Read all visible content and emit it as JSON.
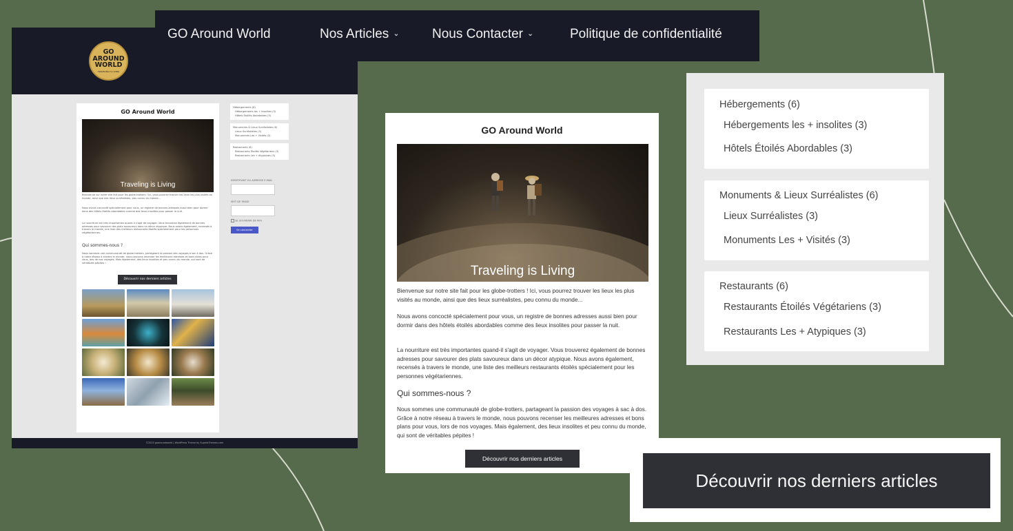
{
  "colors": {
    "background": "#566b4c",
    "header_dark": "#181b27",
    "button_dark": "#2f3036",
    "login_blue": "#4a58c7",
    "logo_gold": "#d9b45a"
  },
  "navbar": {
    "brand": "GO Around World",
    "items": [
      {
        "label": "Nos Articles",
        "icon": "chevron-down-icon"
      },
      {
        "label": "Nous Contacter",
        "icon": "chevron-down-icon"
      },
      {
        "label": "Politique de confidentialité"
      }
    ]
  },
  "logo": {
    "line1": "GO",
    "line2": "AROUND",
    "line3": "WORLD",
    "tagline": "TRAVELING IS LIVING"
  },
  "article": {
    "title": "GO Around World",
    "hero_caption": "Traveling is Living",
    "p1": "Bienvenue sur notre site fait pour les globe-trotters ! Ici, vous pourrez trouver les lieux les plus visités au monde, ainsi que des lieux surréalistes, peu connu du monde...",
    "p2": "Nous avons concocté spécialement pour vous, un registre de bonnes adresses aussi bien pour dormir dans des hôtels étoilés abordables comme des lieux insolites pour passer la nuit.",
    "p3": "La nourriture est très importantes quand-il s'agit de voyager. Vous trouverez également de bonnes adresses pour savourer des plats savoureux dans un décor atypique. Nous avons également, recensés à travers le monde, une liste des meilleurs restaurants étoilés spécialement pour les personnes végétariennes.",
    "h2": "Qui sommes-nous ?",
    "p4": "Nous sommes une communauté de globe-trotters, partageant la passion des voyages à sac à dos. Grâce à notre réseau à travers le monde, nous pouvons recenser les meilleures adresses et bons plans pour vous, lors de nos voyages. Mais également, des lieux insolites et peu connu du monde, qui sont de véritables pépites !",
    "button": "Découvrir nos derniers articles"
  },
  "categories": [
    {
      "label": "Hébergements (6)",
      "subs": [
        "Hébergements les + insolites (3)",
        "Hôtels Étoilés Abordables (3)"
      ]
    },
    {
      "label": "Monuments & Lieux Surréalistes (6)",
      "subs": [
        "Lieux Surréalistes (3)",
        "Monuments Les + Visités (3)"
      ]
    },
    {
      "label": "Restaurants (6)",
      "subs": [
        "Restaurants Étoilés Végétariens (3)",
        "Restaurants Les + Atypiques (3)"
      ]
    }
  ],
  "mini": {
    "login_id_label": "IDENTIFIANT OU ADRESSE E-MAIL",
    "login_pw_label": "MOT DE PASSE",
    "remember_label": "SE SOUVENIR DE MOI",
    "login_button": "Se connecter",
    "footer": "©2023 goaroundworld | WordPress Theme by SuperbThemes.com"
  },
  "zoom_button": "Découvrir nos derniers articles"
}
